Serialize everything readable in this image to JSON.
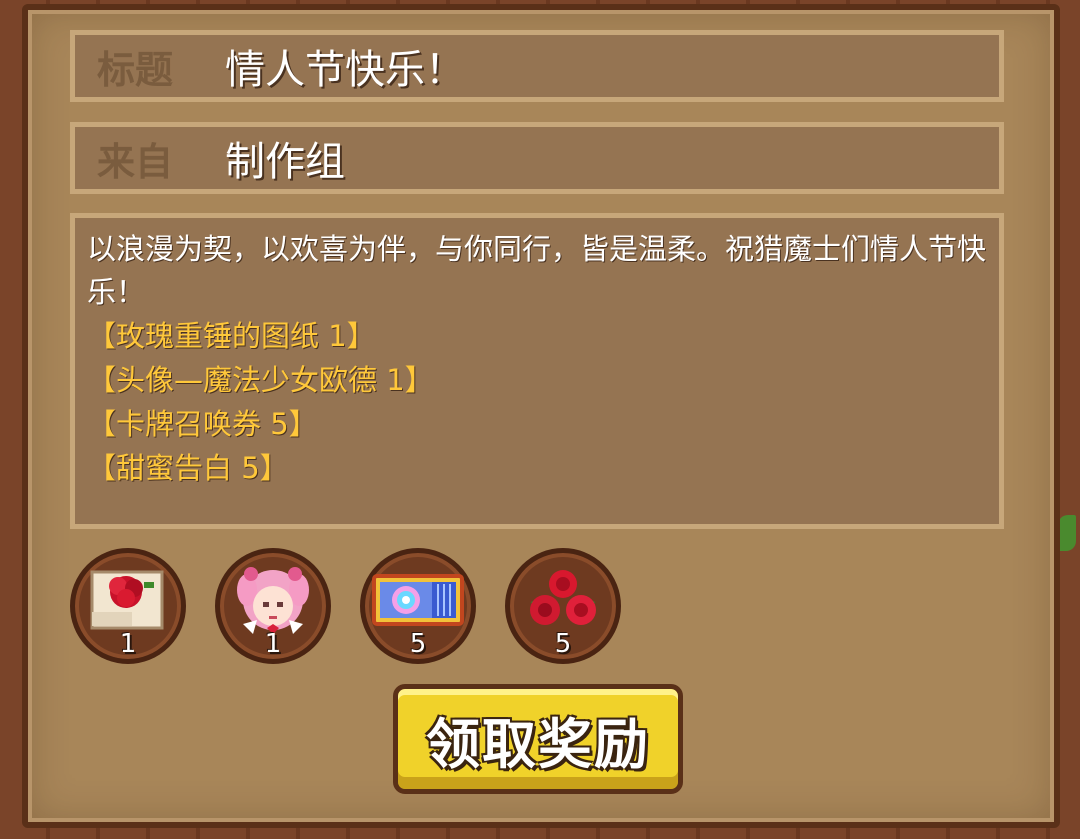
{
  "mail": {
    "title_label": "标题",
    "title_value": "情人节快乐！",
    "from_label": "来自",
    "from_value": "制作组",
    "body_text": "以浪漫为契，以欢喜为伴，与你同行，皆是温柔。祝猎魔士们情人节快乐！",
    "reward_lines": [
      "【玫瑰重锤的图纸 1】",
      "【头像—魔法少女欧德 1】",
      "【卡牌召唤券 5】",
      "【甜蜜告白 5】"
    ]
  },
  "rewards": [
    {
      "icon": "rose-hammer-blueprint-icon",
      "count": "1"
    },
    {
      "icon": "magical-girl-avatar-icon",
      "count": "1"
    },
    {
      "icon": "card-summon-ticket-icon",
      "count": "5"
    },
    {
      "icon": "sweet-confession-roses-icon",
      "count": "5"
    }
  ],
  "claim_button": {
    "label": "领取奖励"
  },
  "colors": {
    "parchment": "#a88659",
    "field_bg": "#957452",
    "reward_text": "#ffc83a",
    "button": "#f0d22a"
  }
}
